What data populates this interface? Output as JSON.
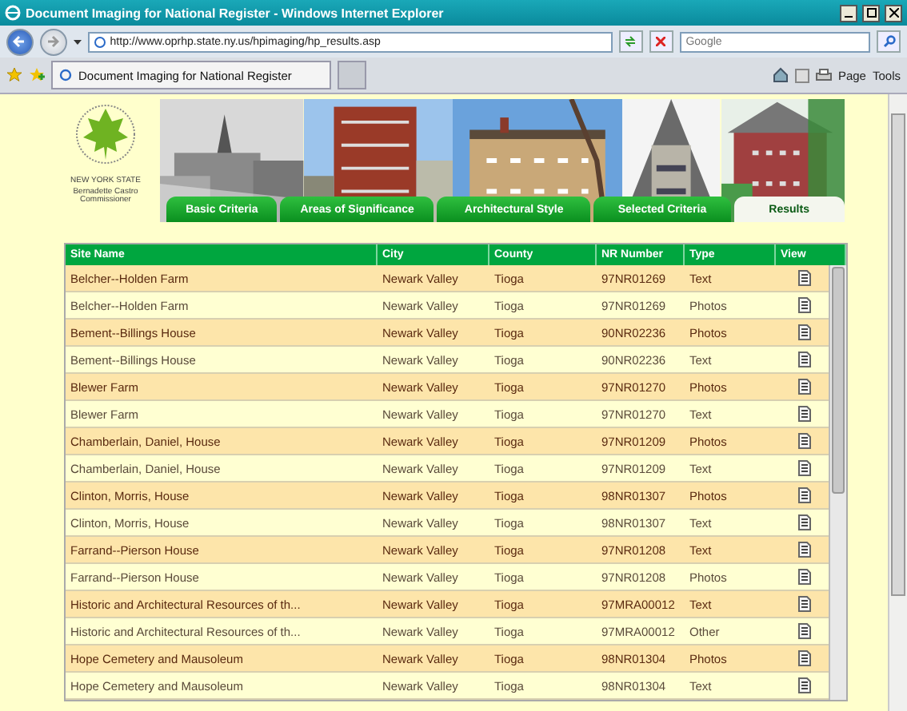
{
  "window": {
    "title": "Document Imaging for National Register - Windows Internet Explorer"
  },
  "address_bar": {
    "url": "http://www.oprhp.state.ny.us/hpimaging/hp_results.asp",
    "search_placeholder": "Google"
  },
  "browser_tabs": [
    {
      "label": "Document Imaging for National Register",
      "selected": true
    }
  ],
  "command_bar": [
    "Page",
    "Tools"
  ],
  "logo": {
    "state": "NEW YORK STATE",
    "caption": "Bernadette Castro Commissioner"
  },
  "nav_tabs": [
    {
      "label": "Basic Criteria",
      "selected": false
    },
    {
      "label": "Areas of Significance",
      "selected": false
    },
    {
      "label": "Architectural Style",
      "selected": false
    },
    {
      "label": "Selected Criteria",
      "selected": false
    },
    {
      "label": "Results",
      "selected": true
    }
  ],
  "table": {
    "columns": [
      "Site Name",
      "City",
      "County",
      "NR Number",
      "Type",
      "View"
    ],
    "rows": [
      [
        "Belcher--Holden Farm",
        "Newark Valley",
        "Tioga",
        "97NR01269",
        "Text"
      ],
      [
        "Belcher--Holden Farm",
        "Newark Valley",
        "Tioga",
        "97NR01269",
        "Photos"
      ],
      [
        "Bement--Billings House",
        "Newark Valley",
        "Tioga",
        "90NR02236",
        "Photos"
      ],
      [
        "Bement--Billings House",
        "Newark Valley",
        "Tioga",
        "90NR02236",
        "Text"
      ],
      [
        "Blewer Farm",
        "Newark Valley",
        "Tioga",
        "97NR01270",
        "Photos"
      ],
      [
        "Blewer Farm",
        "Newark Valley",
        "Tioga",
        "97NR01270",
        "Text"
      ],
      [
        "Chamberlain, Daniel, House",
        "Newark Valley",
        "Tioga",
        "97NR01209",
        "Photos"
      ],
      [
        "Chamberlain, Daniel, House",
        "Newark Valley",
        "Tioga",
        "97NR01209",
        "Text"
      ],
      [
        "Clinton, Morris, House",
        "Newark Valley",
        "Tioga",
        "98NR01307",
        "Photos"
      ],
      [
        "Clinton, Morris, House",
        "Newark Valley",
        "Tioga",
        "98NR01307",
        "Text"
      ],
      [
        "Farrand--Pierson House",
        "Newark Valley",
        "Tioga",
        "97NR01208",
        "Text"
      ],
      [
        "Farrand--Pierson House",
        "Newark Valley",
        "Tioga",
        "97NR01208",
        "Photos"
      ],
      [
        "Historic and Architectural Resources of th...",
        "Newark Valley",
        "Tioga",
        "97MRA00012",
        "Text"
      ],
      [
        "Historic and Architectural Resources of th...",
        "Newark Valley",
        "Tioga",
        "97MRA00012",
        "Other"
      ],
      [
        "Hope Cemetery and Mausoleum",
        "Newark Valley",
        "Tioga",
        "98NR01304",
        "Photos"
      ],
      [
        "Hope Cemetery and Mausoleum",
        "Newark Valley",
        "Tioga",
        "98NR01304",
        "Text"
      ]
    ]
  }
}
